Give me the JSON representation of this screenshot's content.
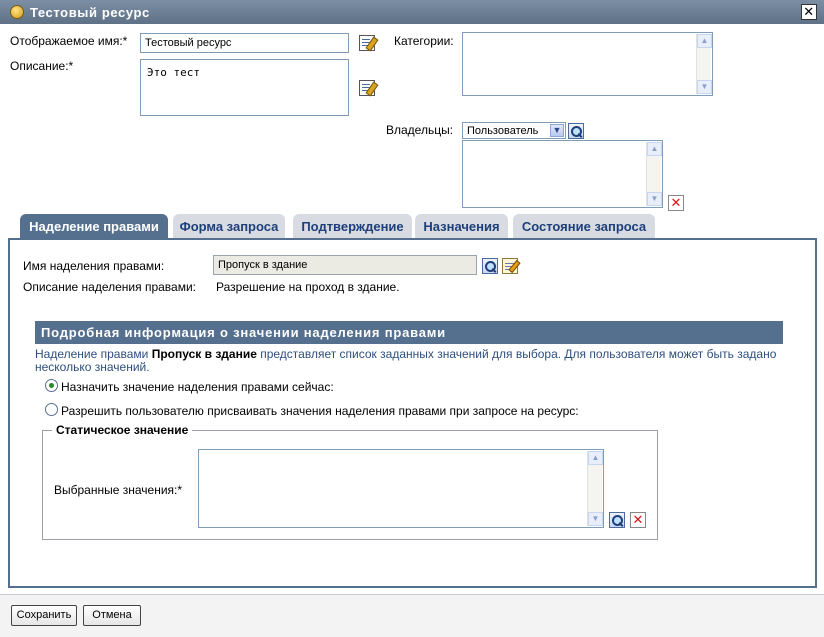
{
  "window": {
    "title": "Тестовый ресурс",
    "icon": "resource-icon",
    "close": "close-icon"
  },
  "form": {
    "display_name_label": "Отображаемое имя:*",
    "display_name_value": "Тестовый ресурс",
    "description_label": "Описание:*",
    "description_value": "Это тест",
    "categories_label": "Категории:",
    "owners_label": "Владельцы:",
    "owners_type_selected": "Пользователь"
  },
  "tabs": [
    {
      "label": "Наделение правами",
      "active": true
    },
    {
      "label": "Форма запроса",
      "active": false
    },
    {
      "label": "Подтверждение",
      "active": false
    },
    {
      "label": "Назначения",
      "active": false
    },
    {
      "label": "Состояние запроса",
      "active": false
    }
  ],
  "entitlement": {
    "name_label": "Имя наделения правами:",
    "name_value": "Пропуск в здание",
    "desc_label": "Описание наделения правами:",
    "desc_value": "Разрешение на проход в здание."
  },
  "details": {
    "header": "Подробная информация о значении наделения правами",
    "intro_prefix": "Наделение правами",
    "intro_bold": "Пропуск в здание",
    "intro_suffix": "представляет список заданных значений для выбора. Для пользователя может быть задано несколько значений.",
    "option_assign_now": "Назначить значение наделения правами сейчас:",
    "option_allow_user": "Разрешить пользователю присваивать значения наделения правами при запросе на ресурс:",
    "static_value_legend": "Статическое значение",
    "selected_values_label": "Выбранные значения:*"
  },
  "footer": {
    "save_label": "Сохранить",
    "cancel_label": "Отмена"
  },
  "colors": {
    "accent": "#55708f",
    "titlebar": "#5e7187",
    "tab_inactive": "#d8dbe2",
    "description_text": "#2d4f7e"
  }
}
